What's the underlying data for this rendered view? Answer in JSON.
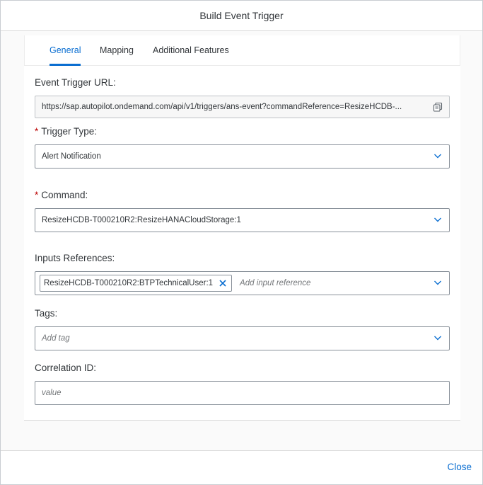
{
  "dialog": {
    "title": "Build Event Trigger",
    "close_label": "Close"
  },
  "tabs": [
    {
      "label": "General",
      "active": true
    },
    {
      "label": "Mapping",
      "active": false
    },
    {
      "label": "Additional Features",
      "active": false
    }
  ],
  "form": {
    "event_trigger_url": {
      "label": "Event Trigger URL:",
      "value": "https://sap.autopilot.ondemand.com/api/v1/triggers/ans-event?commandReference=ResizeHCDB-..."
    },
    "trigger_type": {
      "required_mark": "*",
      "label": "Trigger Type:",
      "value": "Alert Notification"
    },
    "command": {
      "required_mark": "*",
      "label": "Command:",
      "value": "ResizeHCDB-T000210R2:ResizeHANACloudStorage:1"
    },
    "inputs_references": {
      "label": "Inputs References:",
      "token": "ResizeHCDB-T000210R2:BTPTechnicalUser:1",
      "placeholder": "Add input reference"
    },
    "tags": {
      "label": "Tags:",
      "placeholder": "Add tag"
    },
    "correlation_id": {
      "label": "Correlation ID:",
      "placeholder": "value"
    }
  },
  "colors": {
    "accent": "#0a6ed1",
    "required": "#bb0000",
    "text": "#32363a"
  },
  "icons": {
    "copy": "copy-icon",
    "chevron": "chevron-down-icon",
    "token_remove": "close-icon"
  }
}
